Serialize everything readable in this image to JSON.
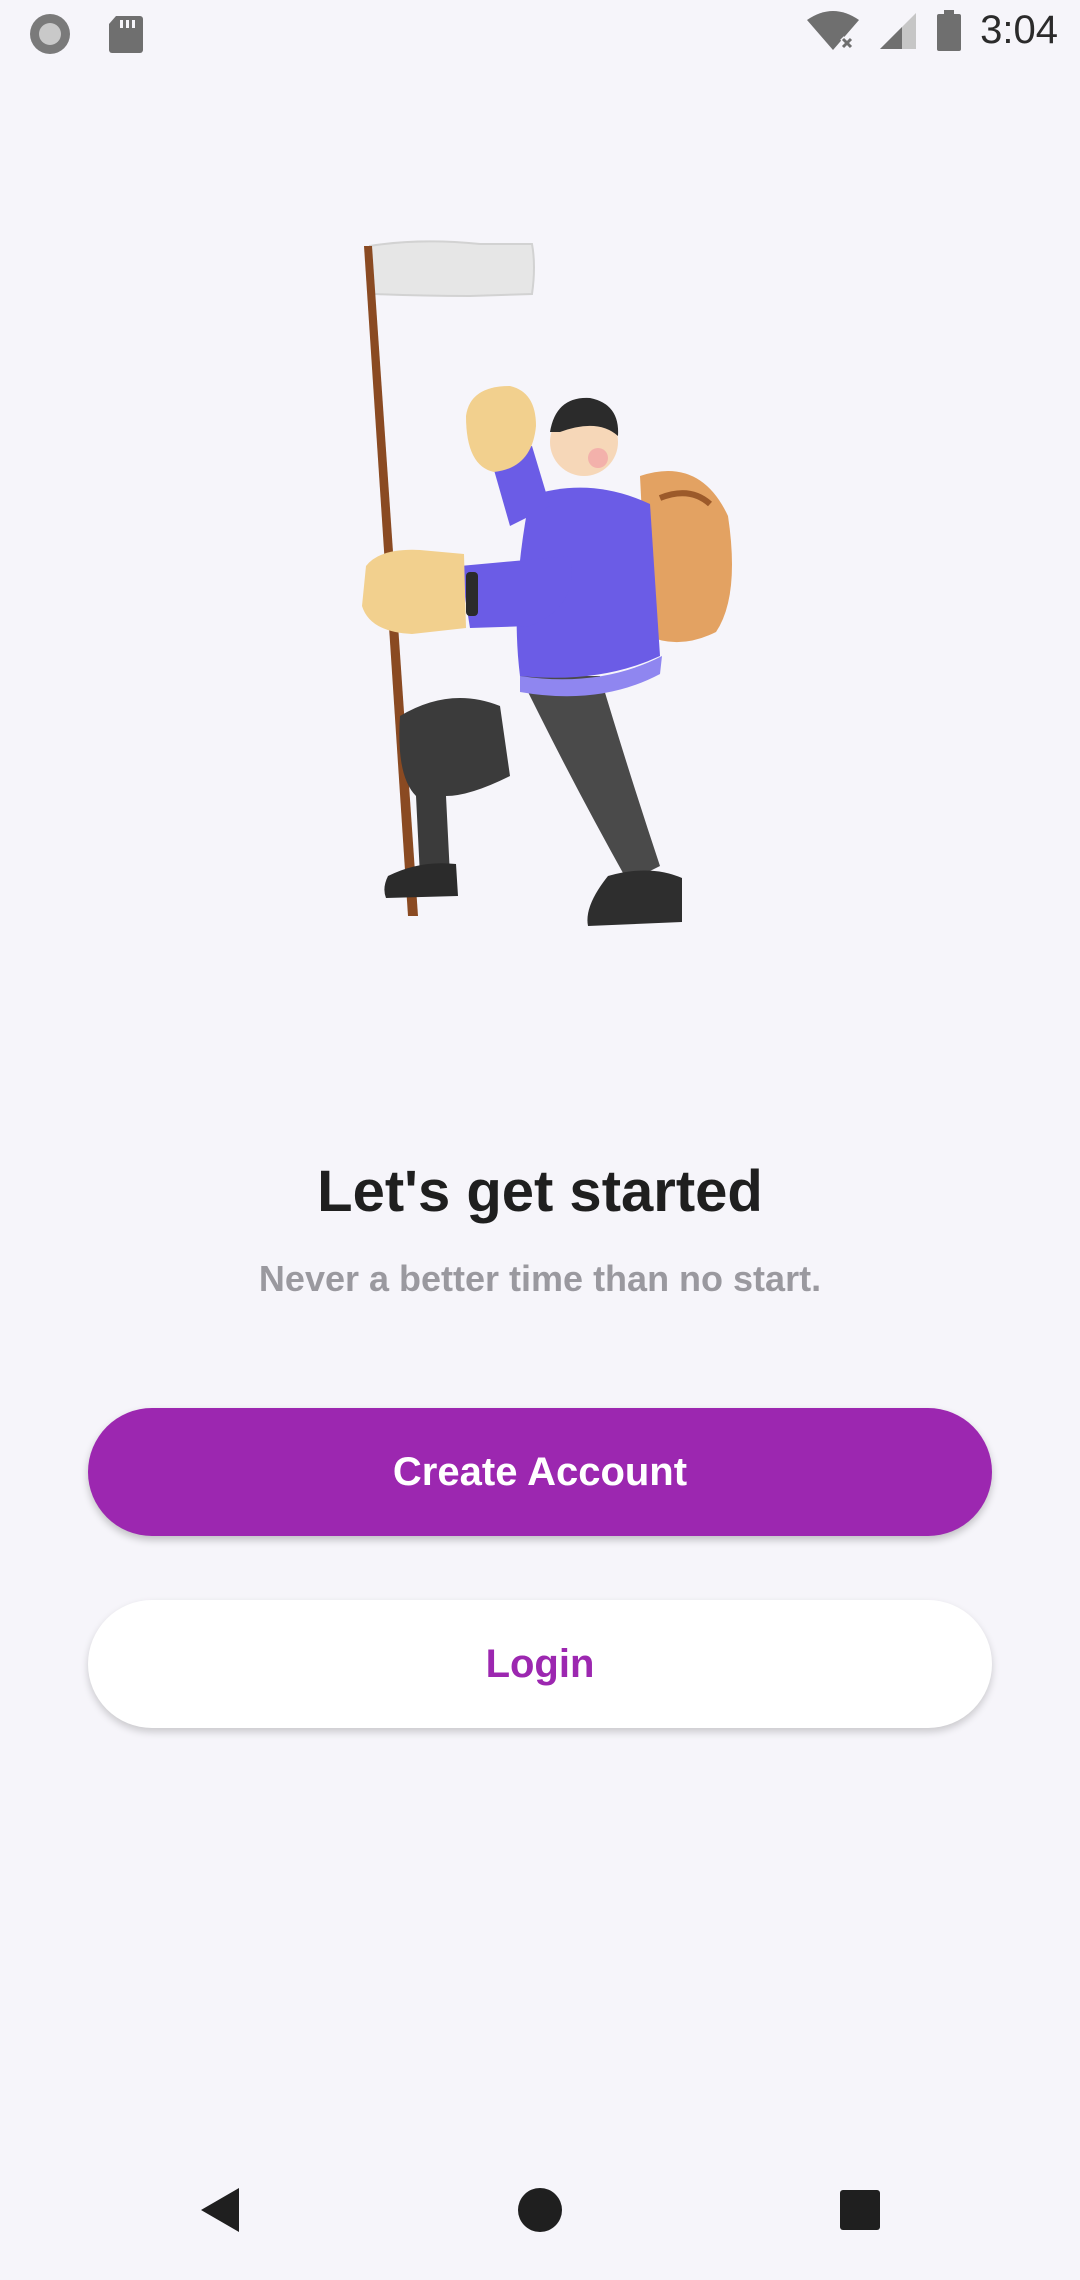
{
  "status_bar": {
    "time": "3:04",
    "icons": [
      "record-icon",
      "sd-card-icon",
      "wifi-icon",
      "signal-icon",
      "battery-icon"
    ]
  },
  "illustration": {
    "name": "hiker-with-flag"
  },
  "onboarding": {
    "title": "Let's get started",
    "subtitle": "Never a better time than no start."
  },
  "actions": {
    "create_account_label": "Create Account",
    "login_label": "Login"
  },
  "colors": {
    "accent": "#9c27b0",
    "background": "#f6f5fa",
    "title": "#1f1f1f",
    "subtitle": "#9a999f"
  },
  "nav_bar": {
    "icons": [
      "back-icon",
      "home-icon",
      "recents-icon"
    ]
  }
}
